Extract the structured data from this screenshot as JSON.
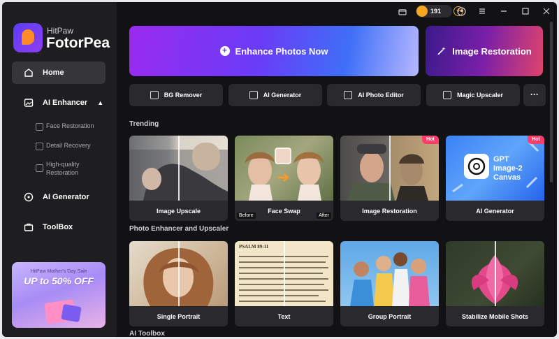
{
  "app": {
    "brand_small": "HitPaw",
    "brand_big": "FotorPea"
  },
  "titlebar": {
    "credits": "191"
  },
  "sidebar": {
    "items": [
      {
        "label": "Home",
        "icon": "home-icon"
      },
      {
        "label": "AI Enhancer",
        "icon": "enhancer-icon"
      },
      {
        "label": "AI Generator",
        "icon": "generator-icon"
      },
      {
        "label": "ToolBox",
        "icon": "toolbox-icon"
      }
    ],
    "sub_items": [
      {
        "label": "Face Restoration"
      },
      {
        "label": "Detail Recovery"
      },
      {
        "label": "High-quality Restoration"
      }
    ],
    "promo": {
      "subtitle": "HitPaw Mother's Day Sale",
      "headline": "UP to 50% OFF"
    }
  },
  "main": {
    "hero": {
      "enhance_label": "Enhance Photos Now",
      "restore_label": "Image Restoration"
    },
    "tools": [
      {
        "label": "BG Remover"
      },
      {
        "label": "AI Generator"
      },
      {
        "label": "AI Photo Editor"
      },
      {
        "label": "Magic Upscaler"
      }
    ],
    "sections": {
      "trending": "Trending",
      "photo_enhancer": "Photo Enhancer and Upscaler",
      "ai_toolbox": "AI Toolbox"
    },
    "trending_cards": [
      {
        "label": "Image Upscale"
      },
      {
        "label": "Face Swap",
        "before": "Before",
        "after": "After"
      },
      {
        "label": "Image Restoration",
        "badge": "Hot"
      },
      {
        "label": "AI Generator",
        "badge": "Hot",
        "art_text": "GPT Image-2 Canvas"
      }
    ],
    "enhancer_cards": [
      {
        "label": "Single Portrait"
      },
      {
        "label": "Text",
        "page_title": "PSALM 89:11"
      },
      {
        "label": "Group Portrait"
      },
      {
        "label": "Stabilize Mobile Shots"
      }
    ]
  },
  "colors": {
    "accent": "#6a3cf7",
    "hot": "#ff3d6b",
    "coin": "#f5a623"
  }
}
